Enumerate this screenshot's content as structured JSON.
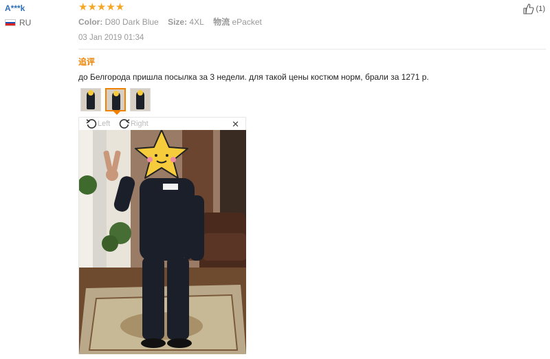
{
  "user": {
    "name": "A***k",
    "country": "RU"
  },
  "review": {
    "stars": "★★★★★",
    "attributes": [
      {
        "key": "Color:",
        "value": "D80 Dark Blue"
      },
      {
        "key": "Size:",
        "value": "4XL"
      },
      {
        "key": "物流",
        "value": "ePacket"
      }
    ],
    "date": "03 Jan 2019 01:34",
    "helpful_count": "(1)",
    "followup_label": "追评",
    "text": "до Белгорода пришла посылка за 3 недели. для такой цены костюм норм, брали за 1271 р.",
    "thumbnail_count": 3,
    "active_thumbnail": 2
  },
  "viewer": {
    "rotate_left_label": "Left",
    "rotate_right_label": "Right",
    "close_label": "✕"
  },
  "colors": {
    "star": "#f5a623",
    "username": "#2e6fb4",
    "followup": "#f08200",
    "active_thumb_border": "#f08200"
  }
}
